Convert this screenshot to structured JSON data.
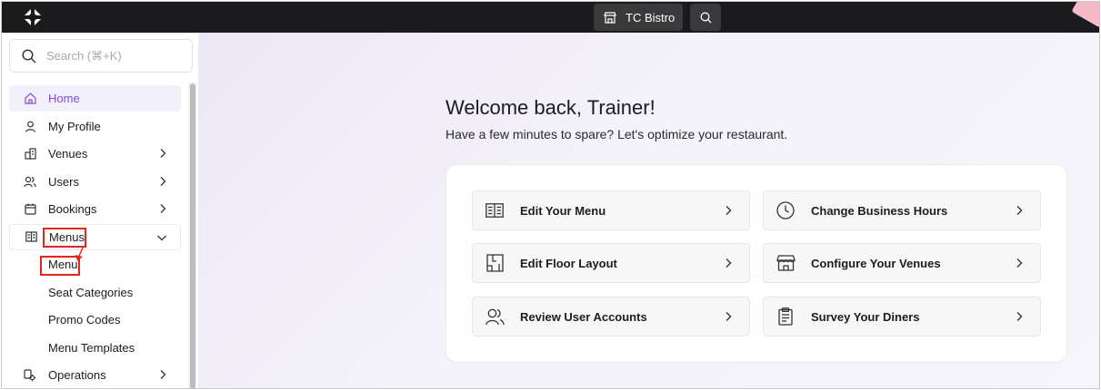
{
  "topbar": {
    "venue_label": "TC Bistro"
  },
  "sidebar": {
    "search_placeholder": "Search (⌘+K)",
    "items": [
      {
        "label": "Home"
      },
      {
        "label": "My Profile"
      },
      {
        "label": "Venues"
      },
      {
        "label": "Users"
      },
      {
        "label": "Bookings"
      },
      {
        "label": "Menus"
      },
      {
        "label": "Operations"
      }
    ],
    "menus_subitems": [
      {
        "label": "Menu"
      },
      {
        "label": "Seat Categories"
      },
      {
        "label": "Promo Codes"
      },
      {
        "label": "Menu Templates"
      }
    ]
  },
  "main": {
    "welcome": "Welcome back, Trainer!",
    "subtitle": "Have a few minutes to spare? Let's optimize your restaurant.",
    "actions": [
      {
        "label": "Edit Your Menu",
        "icon": "menu-book-icon"
      },
      {
        "label": "Change Business Hours",
        "icon": "clock-icon"
      },
      {
        "label": "Edit Floor Layout",
        "icon": "floor-layout-icon"
      },
      {
        "label": "Configure Your Venues",
        "icon": "storefront-icon"
      },
      {
        "label": "Review User Accounts",
        "icon": "users-icon"
      },
      {
        "label": "Survey Your Diners",
        "icon": "clipboard-icon"
      }
    ]
  },
  "colors": {
    "accent": "#8a4bd0",
    "highlight": "#e3261d",
    "topbar": "#1b1b1d"
  }
}
